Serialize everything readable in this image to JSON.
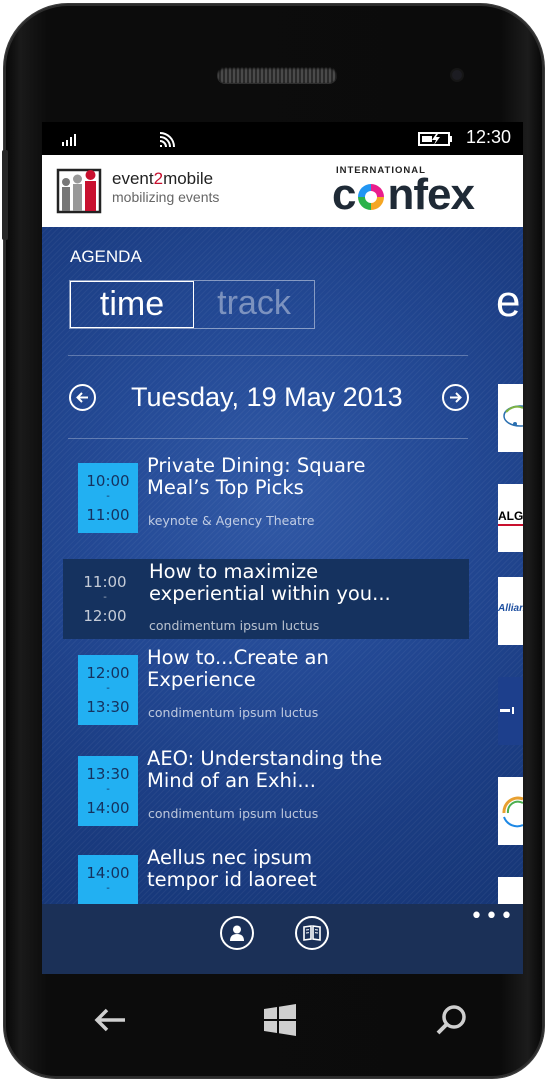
{
  "status": {
    "time": "12:30",
    "signal_icon": "signal-bars-icon",
    "wifi_icon": "wifi-icon",
    "battery_icon": "battery-charging-icon"
  },
  "header": {
    "brand": {
      "part1": "event",
      "part2": "2",
      "part3": "mobile",
      "tagline": "mobilizing events"
    },
    "sponsor": {
      "prefix": "INTERNATIONAL",
      "letter_c": "c",
      "rest": "nfex"
    }
  },
  "agenda": {
    "title": "AGENDA",
    "toggle": {
      "active": "time",
      "inactive": "track"
    },
    "next_panel_peek": "e",
    "date": "Tuesday, 19 May 2013"
  },
  "sessions": [
    {
      "start": "10:00",
      "end": "11:00",
      "title_line1": "Private Dining: Square",
      "title_line2": "Meal’s Top Picks",
      "subtitle": "keynote & Agency Theatre",
      "selected": false
    },
    {
      "start": "11:00",
      "end": "12:00",
      "title_line1": "How to maximize",
      "title_line2": "experiential within you...",
      "subtitle": "condimentum ipsum luctus",
      "selected": true
    },
    {
      "start": "12:00",
      "end": "13:30",
      "title_line1": "How to...Create an",
      "title_line2": "Experience",
      "subtitle": "condimentum ipsum luctus",
      "selected": false
    },
    {
      "start": "13:30",
      "end": "14:00",
      "title_line1": "AEO: Understanding the",
      "title_line2": "Mind of an Exhi...",
      "subtitle": "condimentum ipsum luctus",
      "selected": false
    },
    {
      "start": "14:00",
      "end": "",
      "title_line1": "Aellus nec ipsum",
      "title_line2": "tempor id laoreet",
      "subtitle": "",
      "selected": false
    }
  ],
  "time_separator": "-",
  "sponsor_peek": [
    {
      "text": "",
      "color": "#2a6fb0"
    },
    {
      "text": "ALG",
      "color": "#000000"
    },
    {
      "text": "Allian",
      "color": "#1d4fa0"
    },
    {
      "text": "",
      "color": "#1d3f8c"
    },
    {
      "text": "",
      "color": "#e8a030"
    },
    {
      "text": "",
      "color": "#ffffff"
    }
  ],
  "appbar": {
    "ellipsis": "•••",
    "buttons": [
      "person-icon",
      "book-icon"
    ]
  },
  "hardware": {
    "back": "back-arrow-icon",
    "start": "windows-logo-icon",
    "search": "search-icon"
  },
  "colors": {
    "accent": "#22b0f2",
    "selected_row": "#15325f",
    "appbar": "#1b3057",
    "background": "#1e3f83"
  }
}
